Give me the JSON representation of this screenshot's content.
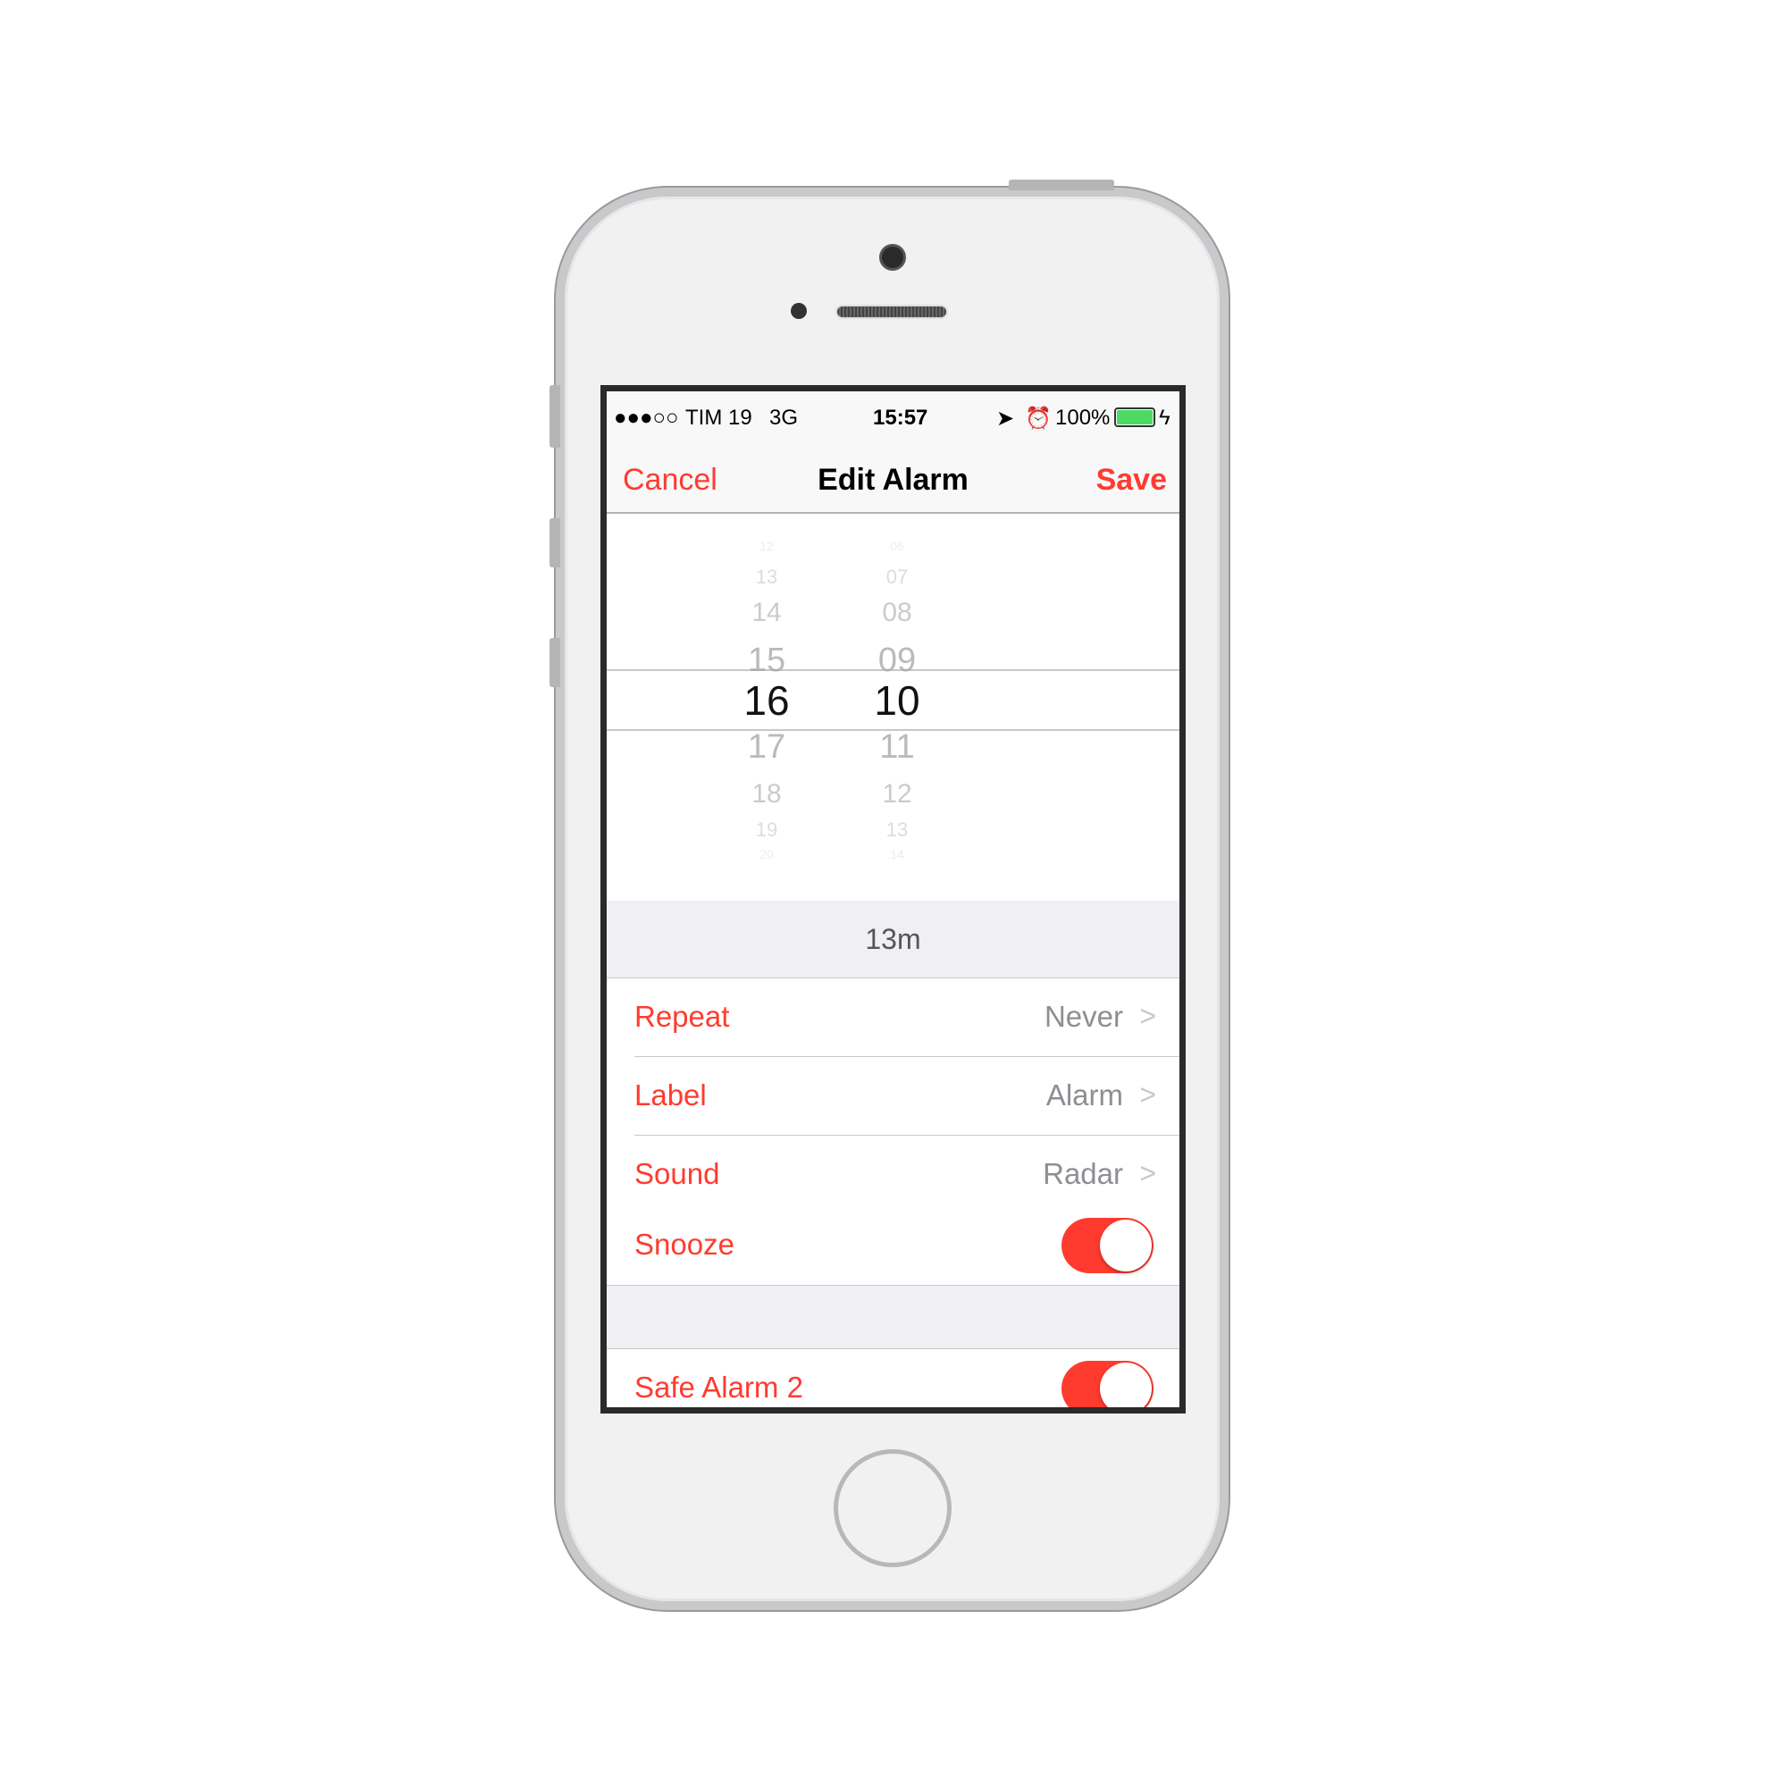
{
  "status_bar": {
    "signal": "●●●○○",
    "carrier": "TIM 19",
    "network": "3G",
    "time": "15:57",
    "location_icon": "location-arrow-icon",
    "alarm_icon": "alarm-clock-icon",
    "battery": "100%",
    "battery_level": 1.0,
    "battery_color": "#4cd964",
    "charging_icon": "lightning-bolt-icon"
  },
  "nav": {
    "cancel": "Cancel",
    "title": "Edit Alarm",
    "save": "Save"
  },
  "picker": {
    "hours": [
      "12",
      "13",
      "14",
      "15",
      "16",
      "17",
      "18",
      "19",
      "20"
    ],
    "minutes": [
      "06",
      "07",
      "08",
      "09",
      "10",
      "11",
      "12",
      "13",
      "14"
    ],
    "selected_hour": "16",
    "selected_minute": "10"
  },
  "time_until": "13m",
  "rows": [
    {
      "label": "Repeat",
      "value": "Never"
    },
    {
      "label": "Label",
      "value": "Alarm"
    },
    {
      "label": "Sound",
      "value": "Radar"
    },
    {
      "label": "Snooze",
      "toggle": true
    }
  ],
  "safe_alarm": {
    "label": "Safe Alarm 2",
    "toggle": true
  },
  "accent_color": "#ff3b30"
}
